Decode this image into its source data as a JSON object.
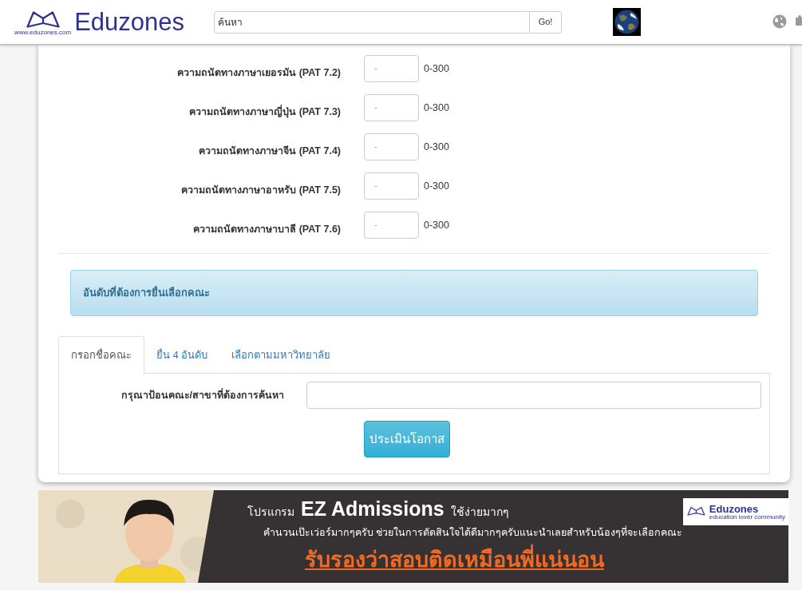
{
  "header": {
    "logo_text": "Eduzones",
    "logo_small": "www.eduzones.com",
    "search": {
      "placeholder": "ค้นหา",
      "button": "Go!"
    }
  },
  "scores": [
    {
      "label": "ความถนัดทางภาษาเยอรมัน (PAT 7.2)",
      "placeholder": "-",
      "range": "0-300"
    },
    {
      "label": "ความถนัดทางภาษาญี่ปุ่น (PAT 7.3)",
      "placeholder": "-",
      "range": "0-300"
    },
    {
      "label": "ความถนัดทางภาษาจีน (PAT 7.4)",
      "placeholder": "-",
      "range": "0-300"
    },
    {
      "label": "ความถนัดทางภาษาอาหรับ (PAT 7.5)",
      "placeholder": "-",
      "range": "0-300"
    },
    {
      "label": "ความถนัดทางภาษาบาลี (PAT 7.6)",
      "placeholder": "-",
      "range": "0-300"
    }
  ],
  "section_heading": "อันดับที่ต้องการยื่นเลือกคณะ",
  "tabs": [
    {
      "label": "กรอกชื่อคณะ",
      "selected": true
    },
    {
      "label": "ยื่น 4 อันดับ",
      "selected": false
    },
    {
      "label": "เลือกตามมหาวิทยาลัย",
      "selected": false
    }
  ],
  "faculty_search": {
    "label": "กรุณาป้อนคณะ/สาขาที่ต้องการค้นหา",
    "button": "ประเมินโอกาส"
  },
  "banner": {
    "prefix": "โปรแกรม",
    "title": "EZ Admissions",
    "suffix": "ใช้ง่ายมากๆ",
    "subtitle": "คำนวนเป๊ะเว่อร์มากๆครับ ช่วยในการตัดสินใจได้ดีมากๆครับแนะนำเลยสำหรับน้องๆที่จะเลือกคณะ",
    "slogan": "รับรองว่าสอบติดเหมือนพี่แน่นอน",
    "logo_text": "Eduzones",
    "logo_tagline": "education lover community"
  }
}
